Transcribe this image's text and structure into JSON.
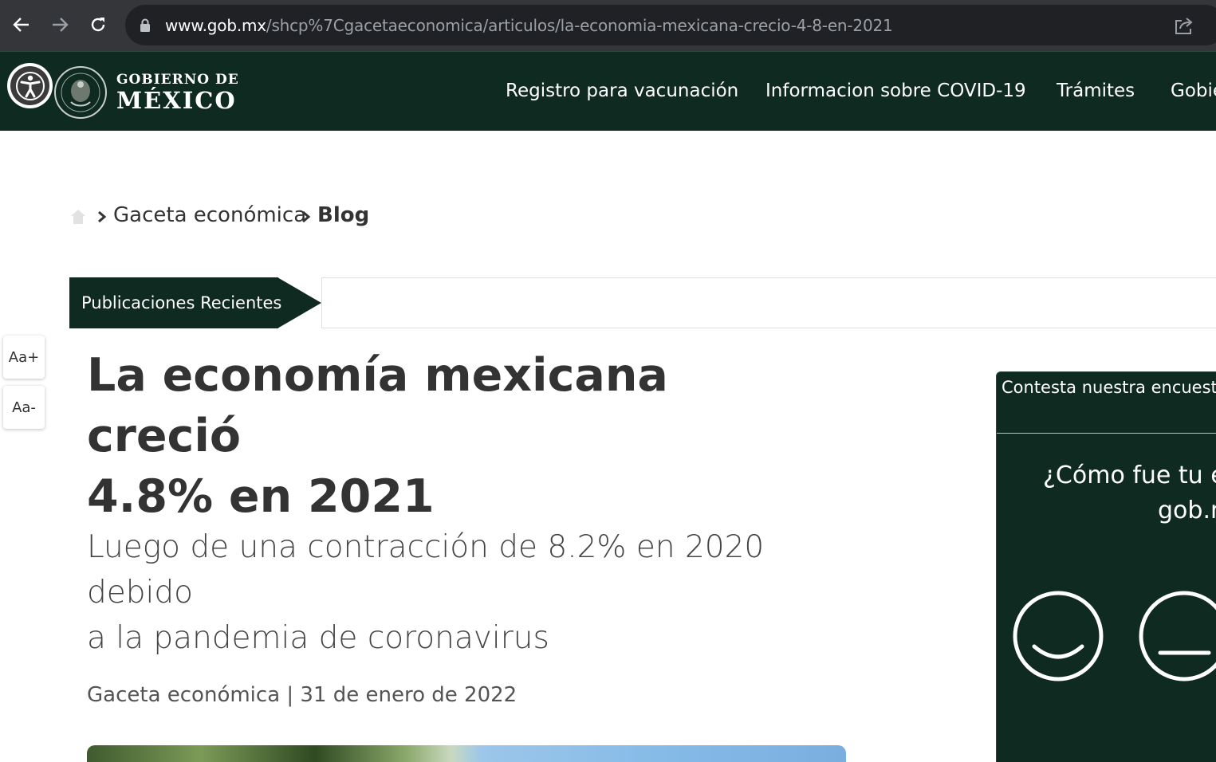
{
  "browser": {
    "url_host": "www.gob.mx",
    "url_path": "/shcp%7Cgacetaeconomica/articulos/la-economia-mexicana-crecio-4-8-en-2021"
  },
  "header": {
    "logo_line1": "GOBIERNO DE",
    "logo_line2": "MÉXICO",
    "nav": [
      "Registro para vacunación",
      "Informacion sobre COVID-19",
      "Trámites",
      "Gobie"
    ]
  },
  "breadcrumb": {
    "items": [
      "Gaceta económica",
      "Blog"
    ]
  },
  "recent": {
    "label": "Publicaciones Recientes"
  },
  "font_controls": {
    "increase": "Aa+",
    "decrease": "Aa-"
  },
  "article": {
    "title_line1": "La economía mexicana creció",
    "title_line2": "4.8% en 2021",
    "subtitle_line1": "Luego de una contracción de 8.2% en 2020 debido",
    "subtitle_line2": "a la pandemia de coronavirus",
    "source": "Gaceta económica",
    "separator": "|",
    "date": "31 de enero de 2022"
  },
  "survey": {
    "header": "Contesta nuestra encuesta",
    "question_line1": "¿Cómo fue tu e",
    "question_line2": "gob.m",
    "options": [
      "happy-face-icon",
      "neutral-face-icon"
    ]
  },
  "colors": {
    "brand_dark_green": "#0f2a21",
    "browser_chrome": "#35363a",
    "omnibox": "#202124"
  }
}
